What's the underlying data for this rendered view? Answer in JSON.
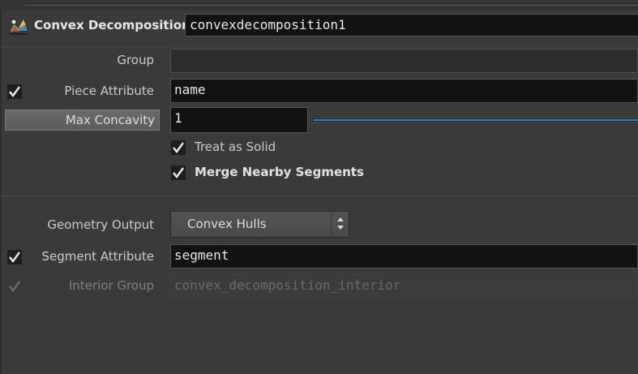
{
  "node": {
    "type_label": "Convex Decomposition",
    "name_value": "convexdecomposition1",
    "icon": "convex-decomposition-node-icon"
  },
  "params": {
    "group": {
      "label": "Group",
      "value": ""
    },
    "piece_attribute": {
      "label": "Piece Attribute",
      "value": "name",
      "enabled": true
    },
    "max_concavity": {
      "label": "Max Concavity",
      "value": "1"
    },
    "treat_as_solid": {
      "label": "Treat as Solid",
      "checked": true
    },
    "merge_nearby_segments": {
      "label": "Merge Nearby Segments",
      "checked": true
    },
    "geometry_output": {
      "label": "Geometry Output",
      "value": "Convex Hulls"
    },
    "segment_attribute": {
      "label": "Segment Attribute",
      "value": "segment",
      "enabled": true
    },
    "interior_group": {
      "label": "Interior Group",
      "value": "convex_decomposition_interior",
      "enabled": true,
      "disabled": true
    }
  },
  "colors": {
    "background": "#3a3a3a",
    "field_bg": "#121212",
    "slider_accent": "#3a7fd0"
  }
}
